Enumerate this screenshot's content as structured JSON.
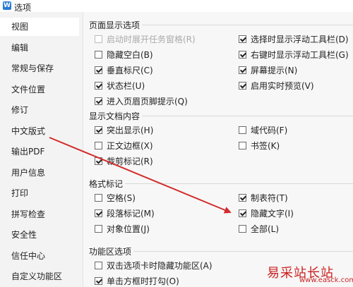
{
  "window": {
    "title": "选项",
    "app_icon": "wps-w-icon",
    "app_icon_glyph": "W"
  },
  "sidebar": {
    "items": [
      {
        "label": "视图",
        "selected": true
      },
      {
        "label": "编辑"
      },
      {
        "label": "常规与保存"
      },
      {
        "label": "文件位置"
      },
      {
        "label": "修订"
      },
      {
        "label": "中文版式"
      },
      {
        "label": "输出PDF"
      },
      {
        "label": "用户信息"
      },
      {
        "label": "打印"
      },
      {
        "label": "拼写检查"
      },
      {
        "label": "安全性"
      },
      {
        "label": "信任中心"
      },
      {
        "label": "自定义功能区"
      }
    ]
  },
  "sections": {
    "page_display": {
      "title": "页面显示选项",
      "left": [
        {
          "label": "启动时展开任务窗格(R)",
          "checked": false,
          "disabled": true
        },
        {
          "label": "隐藏空白(B)",
          "checked": false
        },
        {
          "label": "垂直标尺(C)",
          "checked": true
        },
        {
          "label": "状态栏(U)",
          "checked": true
        },
        {
          "label": "进入页眉页脚提示(Q)",
          "checked": true
        }
      ],
      "right": [
        {
          "label": "选择时显示浮动工具栏(D)",
          "checked": true
        },
        {
          "label": "右键时显示浮动工具栏(G)",
          "checked": true
        },
        {
          "label": "屏幕提示(N)",
          "checked": true
        },
        {
          "label": "启用实时预览(V)",
          "checked": true
        }
      ]
    },
    "doc_content": {
      "title": "显示文档内容",
      "left": [
        {
          "label": "突出显示(H)",
          "checked": true
        },
        {
          "label": "正文边框(X)",
          "checked": false
        },
        {
          "label": "裁剪标记(R)",
          "checked": true
        }
      ],
      "right": [
        {
          "label": "域代码(F)",
          "checked": false
        },
        {
          "label": "书签(K)",
          "checked": false
        }
      ]
    },
    "format_marks": {
      "title": "格式标记",
      "left": [
        {
          "label": "空格(S)",
          "checked": false
        },
        {
          "label": "段落标记(M)",
          "checked": true
        },
        {
          "label": "对象位置(J)",
          "checked": false
        }
      ],
      "right": [
        {
          "label": "制表符(T)",
          "checked": true
        },
        {
          "label": "隐藏文字(I)",
          "checked": true
        },
        {
          "label": "全部(L)",
          "checked": false
        }
      ]
    },
    "ribbon": {
      "title": "功能区选项",
      "left": [
        {
          "label": "双击选项卡时隐藏功能区(A)",
          "checked": false
        },
        {
          "label": "单击方框时打勾(O)",
          "checked": true
        }
      ]
    }
  },
  "annotation": {
    "arrow_color": "#d22b2b"
  },
  "watermark": {
    "text": "易采站长站",
    "sub": "www.easck.com"
  }
}
